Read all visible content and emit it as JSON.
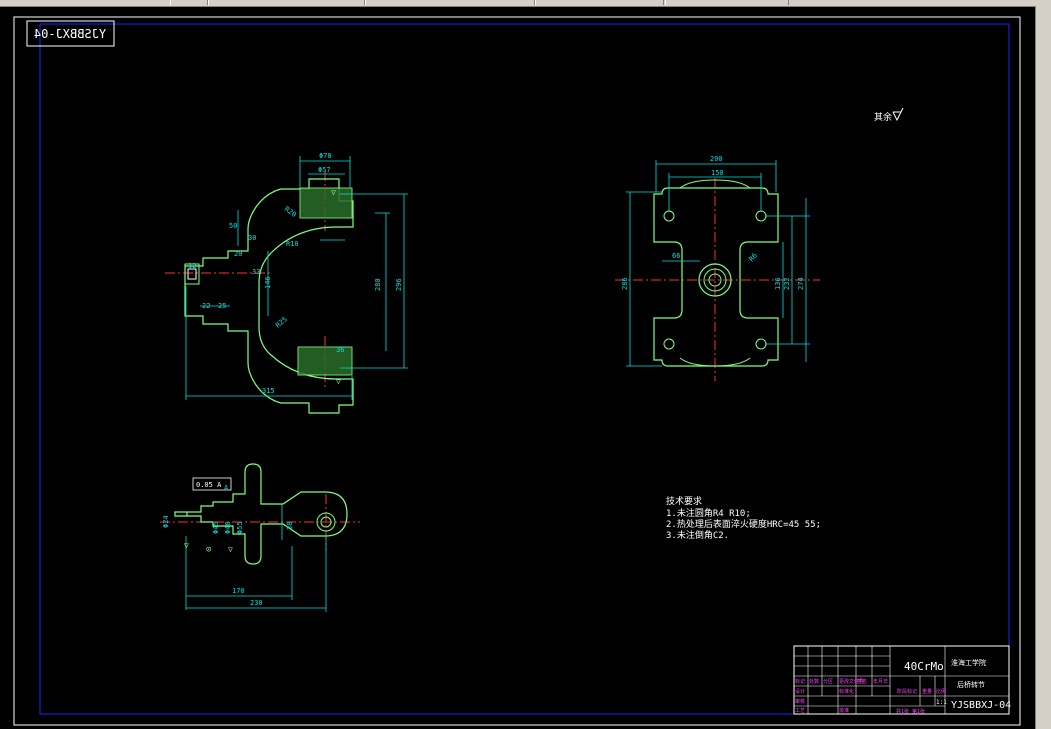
{
  "window": {
    "title": ""
  },
  "drawing": {
    "code_mirrored": "YJSBBXJ-04",
    "roughness_note": "其余",
    "tech_req": {
      "title": "技术要求",
      "items": [
        "1.未注圆角R4 R10;",
        "2.热处理后表面淬火硬度HRC=45 55;",
        "3.未注倒角C2."
      ]
    },
    "title_block": {
      "material": "40CrMo",
      "school": "淮海工学院",
      "part_name": "后桥转节",
      "code": "YJSBBXJ-04",
      "scale": "1:1",
      "sheet": "共1张 第1张",
      "labels": [
        "标记",
        "处数",
        "分区",
        "更改文件号",
        "签名",
        "年月日",
        "设计",
        "标准化",
        "阶段标记",
        "重量",
        "比例",
        "审核",
        "工艺",
        "批准"
      ]
    },
    "dims": {
      "front": [
        "Φ78",
        "Φ57",
        "50",
        "30",
        "20",
        "33",
        "146",
        "280",
        "296",
        "R20",
        "R10",
        "R25",
        "12",
        "22",
        "25",
        "315",
        "36"
      ],
      "side": [
        "200",
        "150",
        "66",
        "R6",
        "235",
        "136",
        "232",
        "274",
        "286"
      ],
      "bottom": [
        "0.05 A",
        "Φ24",
        "Φ45",
        "Φ48",
        "Φ55",
        "38",
        "170",
        "230",
        "A"
      ]
    }
  },
  "colors": {
    "background": "#000000",
    "frame": "#0000ff",
    "outline": "#80ff80",
    "dimension": "#00ffff",
    "centerline": "#ff0000",
    "text": "#ffffff",
    "magenta": "#ff00ff"
  }
}
